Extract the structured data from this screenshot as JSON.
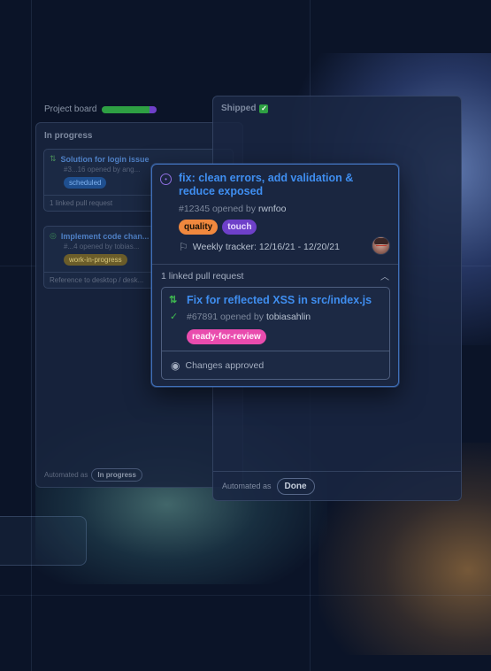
{
  "colors": {
    "accent_blue": "#3f8ef0",
    "label_quality": "#f0883e",
    "label_touch": "#6e40c9",
    "label_ready": "#e94cae",
    "label_scheduled": "#1f4f8f",
    "label_wip": "#7a6a2e",
    "green": "#2ea043"
  },
  "board": {
    "title": "Project board",
    "progress": {
      "done_fraction": 0.86,
      "review_fraction": 0.14
    }
  },
  "in_progress_column": {
    "title": "In progress",
    "cards": [
      {
        "title": "Solution for login issue",
        "meta": "#3...16 opened by ang...",
        "label": "scheduled",
        "footer": "1 linked pull request"
      },
      {
        "title": "Implement code chan...",
        "meta": "#...4 opened by tobias...",
        "label": "work-in-progress",
        "footer": "Reference to desktop / desk..."
      }
    ],
    "automation_prefix": "Automated as",
    "automation_value": "In progress"
  },
  "shipped_column": {
    "title": "Shipped",
    "automation_prefix": "Automated as",
    "automation_value": "Done"
  },
  "popover": {
    "issue": {
      "icon": "issue-progress-icon",
      "title": "fix: clean errors, add validation & reduce exposed",
      "number": "#12345",
      "opened_by_text": "opened by",
      "author": "rwnfoo",
      "labels": [
        "quality",
        "touch"
      ],
      "tracker": "Weekly tracker: 12/16/21 - 12/20/21"
    },
    "linked_header": "1 linked pull request",
    "pull_request": {
      "icon": "git-pull-request-icon",
      "title": "Fix for reflected XSS in src/index.js",
      "number": "#67891",
      "opened_by_text": "opened by",
      "author": "tobiasahlin",
      "label": "ready-for-review",
      "status": "Changes approved"
    }
  }
}
